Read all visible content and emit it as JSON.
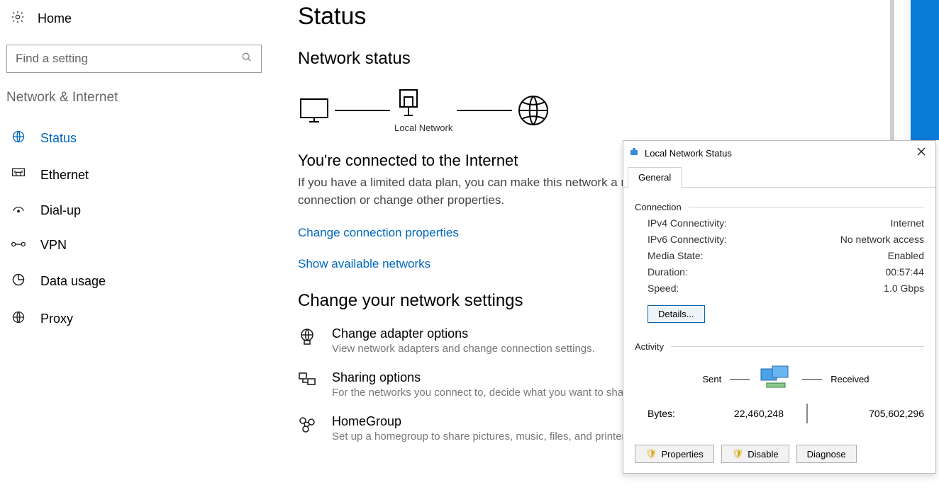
{
  "sidebar": {
    "home": "Home",
    "search_placeholder": "Find a setting",
    "category": "Network & Internet",
    "items": [
      {
        "label": "Status",
        "icon": "status-icon"
      },
      {
        "label": "Ethernet",
        "icon": "ethernet-icon"
      },
      {
        "label": "Dial-up",
        "icon": "dialup-icon"
      },
      {
        "label": "VPN",
        "icon": "vpn-icon"
      },
      {
        "label": "Data usage",
        "icon": "datausage-icon"
      },
      {
        "label": "Proxy",
        "icon": "proxy-icon"
      }
    ]
  },
  "main": {
    "title": "Status",
    "status_heading": "Network status",
    "diagram_caption": "Local Network",
    "connected_heading": "You're connected to the Internet",
    "connected_body": "If you have a limited data plan, you can make this network a metered connection or change other properties.",
    "link_change_props": "Change connection properties",
    "link_show_networks": "Show available networks",
    "change_heading": "Change your network settings",
    "settings": {
      "adapter": {
        "title": "Change adapter options",
        "desc": "View network adapters and change connection settings."
      },
      "sharing": {
        "title": "Sharing options",
        "desc": "For the networks you connect to, decide what you want to share."
      },
      "homegroup": {
        "title": "HomeGroup",
        "desc": "Set up a homegroup to share pictures, music, files, and printers."
      }
    }
  },
  "dialog": {
    "title": "Local Network Status",
    "tab_general": "General",
    "group_connection": "Connection",
    "rows": {
      "ipv4": {
        "k": "IPv4 Connectivity:",
        "v": "Internet"
      },
      "ipv6": {
        "k": "IPv6 Connectivity:",
        "v": "No network access"
      },
      "media": {
        "k": "Media State:",
        "v": "Enabled"
      },
      "dur": {
        "k": "Duration:",
        "v": "00:57:44"
      },
      "speed": {
        "k": "Speed:",
        "v": "1.0 Gbps"
      }
    },
    "details_btn": "Details...",
    "group_activity": "Activity",
    "sent_label": "Sent",
    "recv_label": "Received",
    "bytes_label": "Bytes:",
    "bytes_sent": "22,460,248",
    "bytes_recv": "705,602,296",
    "buttons": {
      "properties": "Properties",
      "disable": "Disable",
      "diagnose": "Diagnose"
    }
  }
}
